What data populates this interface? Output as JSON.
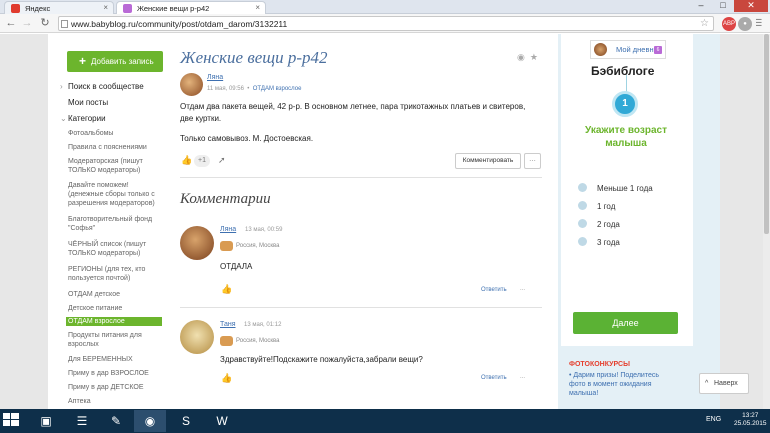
{
  "browser": {
    "tabs": [
      {
        "label": "Яндекс",
        "active": false
      },
      {
        "label": "Женские вещи р-р42",
        "active": true
      }
    ],
    "url": "www.babyblog.ru/community/post/otdam_darom/3132211",
    "window_controls": {
      "minimize": "–",
      "maximize": "□",
      "close": "✕"
    }
  },
  "sidebar": {
    "add_button": "Добавить запись",
    "items": [
      "Поиск в сообществе",
      "Мои посты",
      "Категории"
    ],
    "categories": [
      "Фотоальбомы",
      "Правила с пояснениями",
      "Модераторская (пишут ТОЛЬКО модераторы)",
      "Давайте поможем! (денежные сборы только с разрешения модераторов)",
      "Благотворительный фонд \"Софья\"",
      "ЧЁРНЫЙ список (пишут ТОЛЬКО модераторы)",
      "РЕГИОНЫ (для тех, кто пользуется почтой)",
      "ОТДАМ детское",
      "Детское питание",
      "ОТДАМ взрослое",
      "Продукты питания для взрослых",
      "Для БЕРЕМЕННЫХ",
      "Приму в дар ВЗРОСЛОЕ",
      "Приму в дар ДЕТСКОЕ",
      "Аптека"
    ],
    "selected_category": "ОТДАМ взрослое"
  },
  "post": {
    "title": "Женские вещи р-р42",
    "author": "Ляна",
    "date": "11 мая, 09:56",
    "category_tag": "ОТДАМ взрослое",
    "text": "Отдам два пакета вещей, 42 р-р. В основном летнее, пара трикотажных платьев и свитеров, две куртки.",
    "text2": "Только самовывоз. М. Достоевская.",
    "likes": "+1",
    "comment_button": "Комментировать",
    "more_button": "..."
  },
  "comments": {
    "heading": "Комментарии",
    "list": [
      {
        "author": "Ляна",
        "date": "13 мая, 00:59",
        "location": "Россия, Москва",
        "text": "ОТДАЛА",
        "reply": "Ответить"
      },
      {
        "author": "Таня",
        "date": "13 мая, 01:12",
        "location": "Россия, Москва",
        "text": "Здравствуйте!Подскажите пожалуйста,забрали вещи?",
        "reply": "Ответить"
      }
    ]
  },
  "right_panel": {
    "my_diary": "Мой дневник",
    "diary_badge": "6",
    "brand": "Бэбиблоге",
    "step": "1",
    "step_title": "Укажите возраст малыша",
    "options": [
      "Меньше 1 года",
      "1 год",
      "2 года",
      "3 года"
    ],
    "next_button": "Далее",
    "contests_heading": "ФОТОКОНКУРСЫ",
    "contests_text": "• Дарим призы! Поделитесь фото в момент ожидания малыша!",
    "back_button": "Наверх"
  },
  "taskbar": {
    "lang": "ENG",
    "time": "13:27",
    "date": "25.05.2015"
  },
  "colors": {
    "green": "#6cb52d",
    "blue_link": "#3e70b0",
    "accent_blue": "#31a9d6",
    "red": "#e5402f"
  }
}
